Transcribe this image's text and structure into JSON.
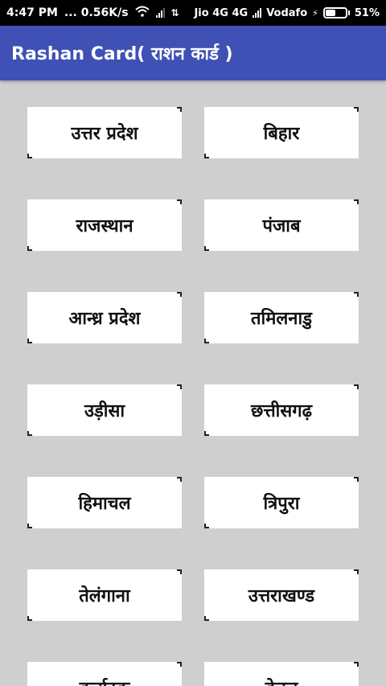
{
  "status_bar": {
    "time": "4:47 PM",
    "speed": "... 0.56K/s",
    "carrier1": "Jio 4G 4G",
    "carrier2": "Vodafo",
    "battery_percent": "51%",
    "battery_level": 0.51
  },
  "app_bar": {
    "title": "Rashan Card( राशन कार्ड )"
  },
  "states": [
    "उत्तर प्रदेश",
    "बिहार",
    "राजस्थान",
    "पंजाब",
    "आन्ध्र प्रदेश",
    "तमिलनाडु",
    "उड़ीसा",
    "छत्तीसगढ़",
    "हिमाचल",
    "त्रिपुरा",
    "तेलंगाना",
    "उत्तराखण्ड",
    "कर्नाटक",
    "केरल"
  ]
}
